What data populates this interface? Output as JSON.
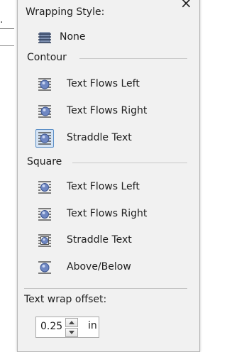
{
  "panel": {
    "heading": "Wrapping Style:",
    "none_option": {
      "label": "None",
      "icon": "wrap-none-icon"
    },
    "sections": [
      {
        "title": "Contour",
        "options": [
          {
            "label": "Text Flows Left",
            "icon": "wrap-flows-left-icon",
            "selected": false
          },
          {
            "label": "Text Flows Right",
            "icon": "wrap-flows-right-icon",
            "selected": false
          },
          {
            "label": "Straddle Text",
            "icon": "wrap-straddle-icon",
            "selected": true
          }
        ]
      },
      {
        "title": "Square",
        "options": [
          {
            "label": "Text Flows Left",
            "icon": "wrap-flows-left-icon",
            "selected": false
          },
          {
            "label": "Text Flows Right",
            "icon": "wrap-flows-right-icon",
            "selected": false
          },
          {
            "label": "Straddle Text",
            "icon": "wrap-straddle-icon",
            "selected": false
          },
          {
            "label": "Above/Below",
            "icon": "wrap-above-below-icon",
            "selected": false
          }
        ]
      }
    ],
    "offset": {
      "label": "Text wrap offset:",
      "value": "0.25",
      "unit": "in"
    },
    "close_glyph": "×",
    "colors": {
      "panel_bg": "#f1f1f1",
      "selection_fill": "#d4e3f4",
      "selection_border": "#5b8fc7"
    }
  }
}
